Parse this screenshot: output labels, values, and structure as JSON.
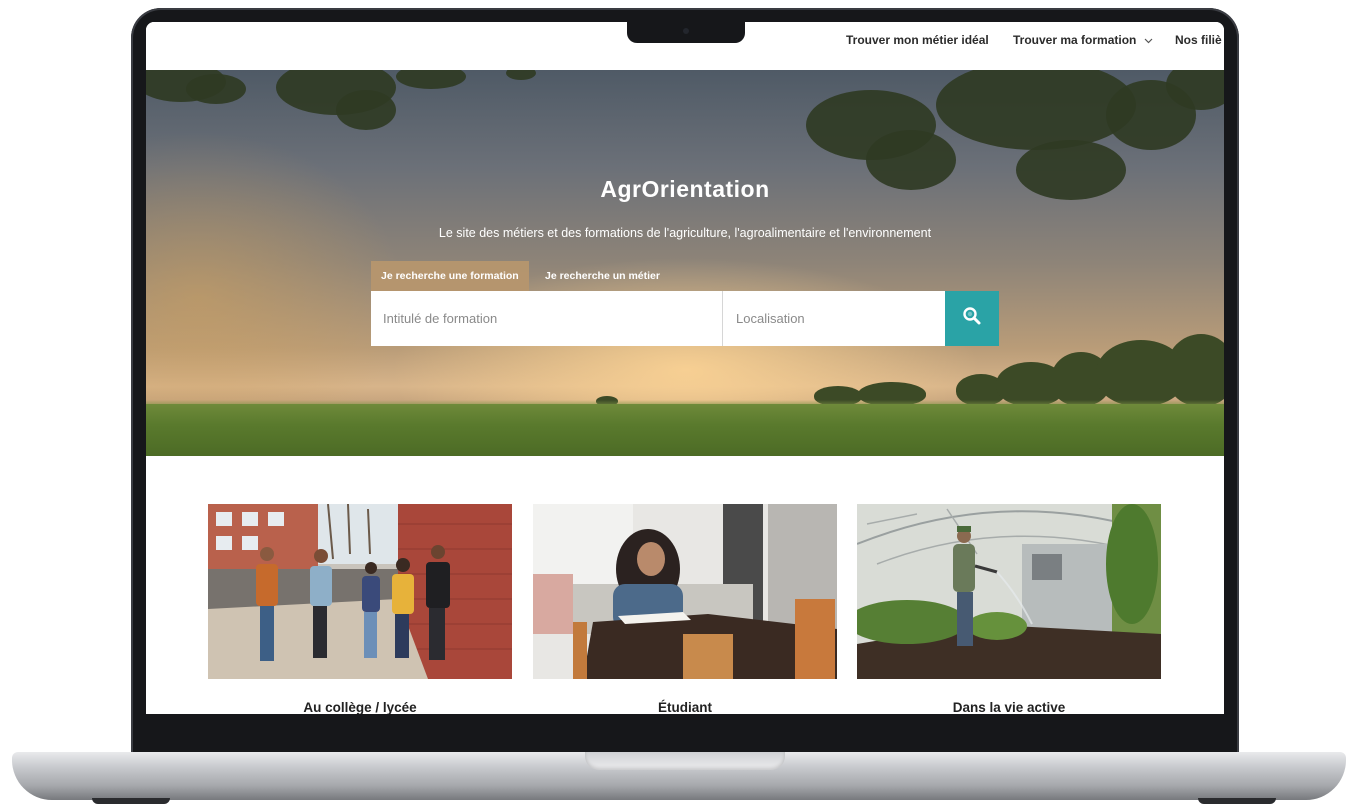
{
  "nav": {
    "items": [
      {
        "label": "Trouver mon métier idéal"
      },
      {
        "label": "Trouver ma formation",
        "has_dropdown": true
      },
      {
        "label": "Nos filiè"
      }
    ]
  },
  "hero": {
    "title": "AgrOrientation",
    "subtitle": "Le site des métiers et des formations de l'agriculture, l'agroalimentaire et l'environnement",
    "tabs": [
      {
        "label": "Je recherche une formation",
        "active": true
      },
      {
        "label": "Je recherche un métier",
        "active": false
      }
    ],
    "search": {
      "formation_placeholder": "Intitulé de formation",
      "location_placeholder": "Localisation",
      "button_icon": "search-icon",
      "button_color": "#2aa3a6"
    }
  },
  "cards": [
    {
      "label": "Au collège / lycée",
      "image": "students-walking-photo"
    },
    {
      "label": "Étudiant",
      "image": "student-studying-photo"
    },
    {
      "label": "Dans la vie active",
      "image": "greenhouse-worker-photo"
    }
  ]
}
